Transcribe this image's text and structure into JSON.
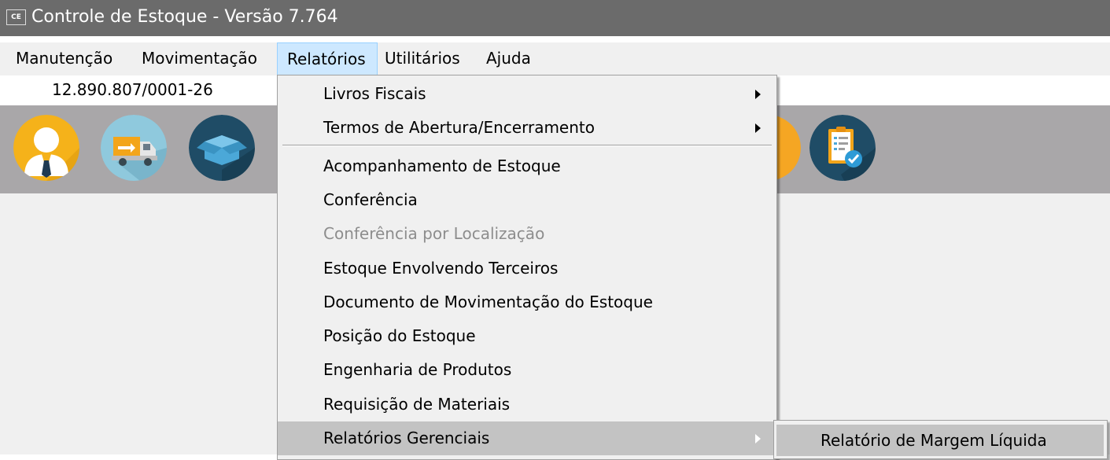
{
  "window": {
    "icon_text": "CE",
    "title": "Controle de Estoque - Versão 7.764"
  },
  "menubar": {
    "items": [
      {
        "label": "Manutenção"
      },
      {
        "label": "Movimentação"
      },
      {
        "label": "Relatórios"
      },
      {
        "label": "Utilitários"
      },
      {
        "label": "Ajuda"
      }
    ],
    "active": "Relatórios"
  },
  "company": {
    "cnpj": "12.890.807/0001-26"
  },
  "toolbar": {
    "icons": [
      "user-icon",
      "delivery-truck-icon",
      "box-icon",
      "checklist-icon"
    ]
  },
  "dropdown": {
    "items": [
      {
        "label": "Livros Fiscais",
        "submenu": true
      },
      {
        "label": "Termos de Abertura/Encerramento",
        "submenu": true
      },
      {
        "label": "Acompanhamento de Estoque"
      },
      {
        "label": "Conferência"
      },
      {
        "label": "Conferência por Localização",
        "disabled": true
      },
      {
        "label": "Estoque Envolvendo Terceiros"
      },
      {
        "label": "Documento de Movimentação do Estoque"
      },
      {
        "label": "Posição do Estoque"
      },
      {
        "label": "Engenharia de Produtos"
      },
      {
        "label": "Requisição de Materiais"
      },
      {
        "label": "Relatórios Gerenciais",
        "submenu": true,
        "highlighted": true
      }
    ]
  },
  "submenu": {
    "items": [
      {
        "label": "Relatório de Margem Líquida",
        "highlighted": true
      }
    ]
  },
  "colors": {
    "titlebar": "#6b6b6b",
    "toolbar": "#a9a7a9",
    "menu_background": "#f0f0f0",
    "highlight": "#c3c3c3",
    "active_menu": "#cde8ff"
  }
}
